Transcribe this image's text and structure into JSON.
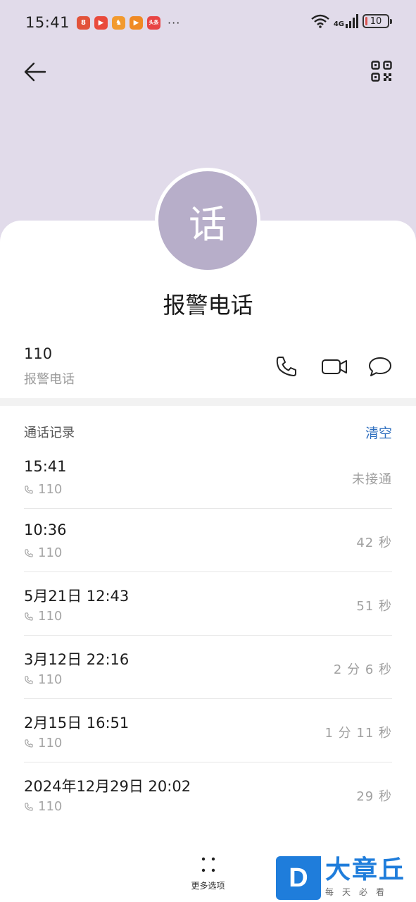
{
  "status_bar": {
    "time": "15:41",
    "notification_icons": [
      {
        "name": "app-notification-icon-1",
        "color": "#e2533a",
        "glyph": "8"
      },
      {
        "name": "app-notification-icon-2",
        "color": "#e94a3c",
        "glyph": "▶"
      },
      {
        "name": "app-notification-icon-3",
        "color": "#f29a2e",
        "glyph": "♞"
      },
      {
        "name": "app-notification-icon-4",
        "color": "#f08a24",
        "glyph": "▶"
      },
      {
        "name": "app-notification-icon-5",
        "color": "#e84545",
        "glyph": "头条"
      }
    ],
    "more": "···",
    "network": "4G",
    "battery_level": "10",
    "battery_fraction": 0.1
  },
  "header": {
    "back_icon": "arrow-left-icon",
    "qr_icon": "qr-code-icon"
  },
  "contact": {
    "avatar_char": "话",
    "avatar_color": "#b7aec9",
    "name": "报警电话",
    "number": "110",
    "number_label": "报警电话"
  },
  "actions": {
    "call_icon": "phone-icon",
    "video_icon": "video-call-icon",
    "message_icon": "message-icon"
  },
  "call_log": {
    "title": "通话记录",
    "clear_label": "清空",
    "items": [
      {
        "time": "15:41",
        "number": "110",
        "duration": "未接通"
      },
      {
        "time": "10:36",
        "number": "110",
        "duration": "42 秒"
      },
      {
        "time": "5月21日 12:43",
        "number": "110",
        "duration": "51 秒"
      },
      {
        "time": "3月12日 22:16",
        "number": "110",
        "duration": "2 分 6 秒"
      },
      {
        "time": "2月15日 16:51",
        "number": "110",
        "duration": "1 分 11 秒"
      },
      {
        "time": "2024年12月29日 20:02",
        "number": "110",
        "duration": "29 秒"
      }
    ]
  },
  "bottom": {
    "more_options_label": "更多选项"
  },
  "watermark": {
    "logo_char": "D",
    "title": "大章丘",
    "subtitle": "每天必看"
  },
  "colors": {
    "header_bg": "#e1dbea",
    "accent": "#2f6fbf",
    "watermark_blue": "#1f7ddb"
  }
}
